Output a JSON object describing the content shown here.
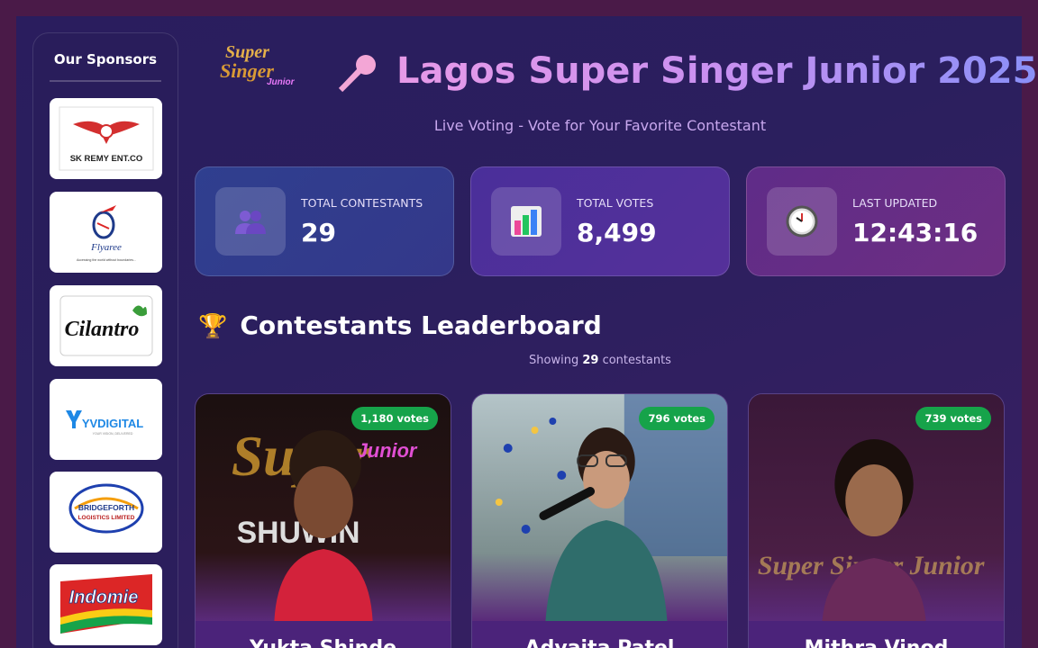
{
  "sidebar": {
    "title": "Our Sponsors",
    "sponsors": [
      {
        "name": "SK REMY ENT.CO",
        "icon": "sk-remy-logo"
      },
      {
        "name": "Flyaree",
        "tagline": "Accessing the world without boundaries...",
        "icon": "flyaree-logo"
      },
      {
        "name": "Cilantro",
        "icon": "cilantro-logo"
      },
      {
        "name": "YVDIGITAL",
        "tagline": "YOUR VISION, DELIVERED",
        "icon": "yvdigital-logo"
      },
      {
        "name": "BRIDGEFORTH",
        "subtitle": "LOGISTICS LIMITED",
        "icon": "bridgeforth-logo"
      },
      {
        "name": "Indomie",
        "icon": "indomie-logo"
      }
    ]
  },
  "header": {
    "logo_text": [
      "Super",
      "Singer",
      "Junior"
    ],
    "title": "Lagos Super Singer Junior 2025",
    "subtitle": "Live Voting - Vote for Your Favorite Contestant"
  },
  "stats": [
    {
      "label": "TOTAL CONTESTANTS",
      "value": "29",
      "icon": "people-icon"
    },
    {
      "label": "TOTAL VOTES",
      "value": "8,499",
      "icon": "bar-chart-icon"
    },
    {
      "label": "LAST UPDATED",
      "value": "12:43:16",
      "icon": "clock-icon"
    }
  ],
  "leaderboard": {
    "title": "Contestants Leaderboard",
    "showing_prefix": "Showing",
    "showing_count": "29",
    "showing_suffix": "contestants",
    "contestants": [
      {
        "votes": "1,180 votes",
        "name": "Yukta Shinde",
        "photo_text": "SHUWIN"
      },
      {
        "votes": "796 votes",
        "name": "Advaita Patel"
      },
      {
        "votes": "739 votes",
        "name": "Mithra Vinod",
        "photo_text": "Super Singer Junior"
      }
    ]
  },
  "colors": {
    "accent_pink": "#e79ae8",
    "accent_blue": "#8a90f8",
    "vote_badge": "#16a34a"
  }
}
